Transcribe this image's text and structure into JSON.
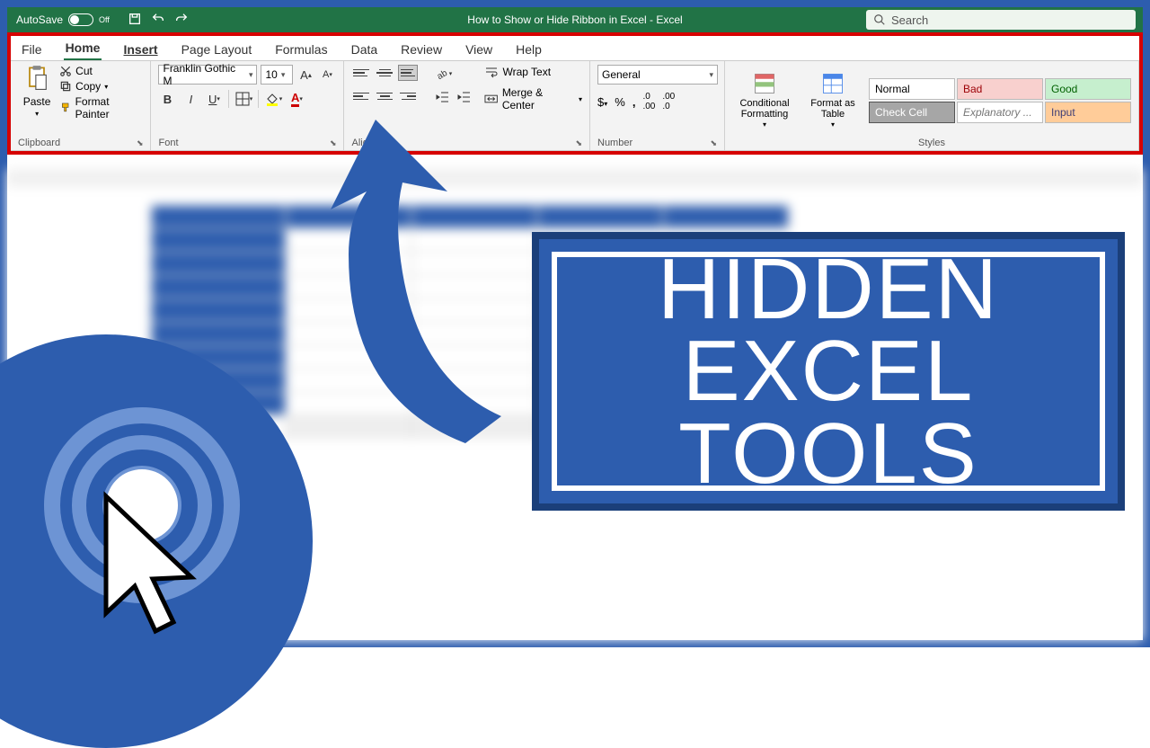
{
  "titlebar": {
    "autosave_label": "AutoSave",
    "autosave_state": "Off",
    "title": "How to Show or Hide Ribbon in Excel  -  Excel",
    "search_placeholder": "Search"
  },
  "tabs": [
    "File",
    "Home",
    "Insert",
    "Page Layout",
    "Formulas",
    "Data",
    "Review",
    "View",
    "Help"
  ],
  "clipboard": {
    "paste": "Paste",
    "cut": "Cut",
    "copy": "Copy",
    "format_painter": "Format Painter",
    "group": "Clipboard"
  },
  "font": {
    "name": "Franklin Gothic M",
    "size": "10",
    "group": "Font"
  },
  "alignment": {
    "wrap": "Wrap Text",
    "merge": "Merge & Center",
    "group": "Alignment"
  },
  "number": {
    "format": "General",
    "group": "Number"
  },
  "styles": {
    "conditional": "Conditional Formatting",
    "format_table": "Format as Table",
    "cells": {
      "normal": "Normal",
      "bad": "Bad",
      "good": "Good",
      "check": "Check Cell",
      "explanatory": "Explanatory ...",
      "input": "Input"
    },
    "group": "Styles"
  },
  "callout": {
    "line1": "HIDDEN",
    "line2": "EXCEL TOOLS"
  }
}
